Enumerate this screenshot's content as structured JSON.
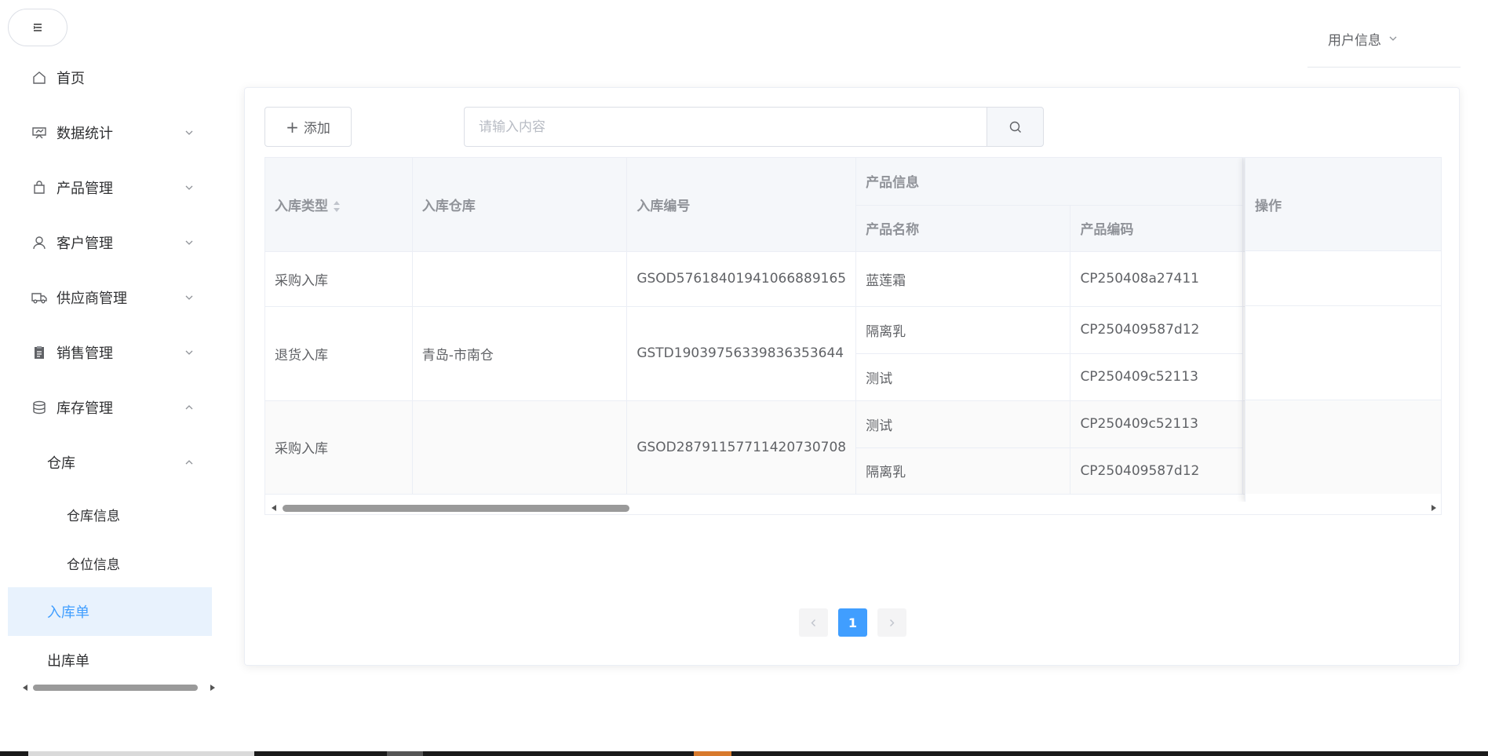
{
  "sidebar": {
    "menu": [
      {
        "label": "首页",
        "icon": "home-icon"
      },
      {
        "label": "数据统计",
        "icon": "chart-icon"
      },
      {
        "label": "产品管理",
        "icon": "shopping-bag-icon"
      },
      {
        "label": "客户管理",
        "icon": "user-icon"
      },
      {
        "label": "供应商管理",
        "icon": "truck-icon"
      },
      {
        "label": "销售管理",
        "icon": "clipboard-icon"
      },
      {
        "label": "库存管理",
        "icon": "database-icon"
      }
    ],
    "warehouse_group": "仓库",
    "warehouse_children": [
      "仓库信息",
      "仓位信息"
    ],
    "active_item": "入库单",
    "next_item": "出库单"
  },
  "header": {
    "user_info": "用户信息"
  },
  "toolbar": {
    "add_label": "添加",
    "search_placeholder": "请输入内容",
    "search_value": ""
  },
  "table": {
    "headers": {
      "type": "入库类型",
      "warehouse": "入库仓库",
      "code": "入库编号",
      "product_group": "产品信息",
      "product_name": "产品名称",
      "product_code": "产品编码",
      "actions": "操作"
    },
    "rows": [
      {
        "type": "采购入库",
        "warehouse": "",
        "code": "GSOD57618401941066889165",
        "products": [
          {
            "name": "蓝莲霜",
            "code": "CP250408a27411"
          }
        ]
      },
      {
        "type": "退货入库",
        "warehouse": "青岛-市南仓",
        "code": "GSTD19039756339836353644",
        "products": [
          {
            "name": "隔离乳",
            "code": "CP250409587d12"
          },
          {
            "name": "测试",
            "code": "CP250409c52113"
          }
        ]
      },
      {
        "type": "采购入库",
        "warehouse": "",
        "code": "GSOD28791157711420730708",
        "products": [
          {
            "name": "测试",
            "code": "CP250409c52113"
          },
          {
            "name": "隔离乳",
            "code": "CP250409587d12"
          }
        ]
      }
    ]
  },
  "pagination": {
    "current_page": "1"
  },
  "colors": {
    "accent": "#409eff",
    "active_bg": "#e8f2fd",
    "header_bg": "#f5f7fa"
  }
}
